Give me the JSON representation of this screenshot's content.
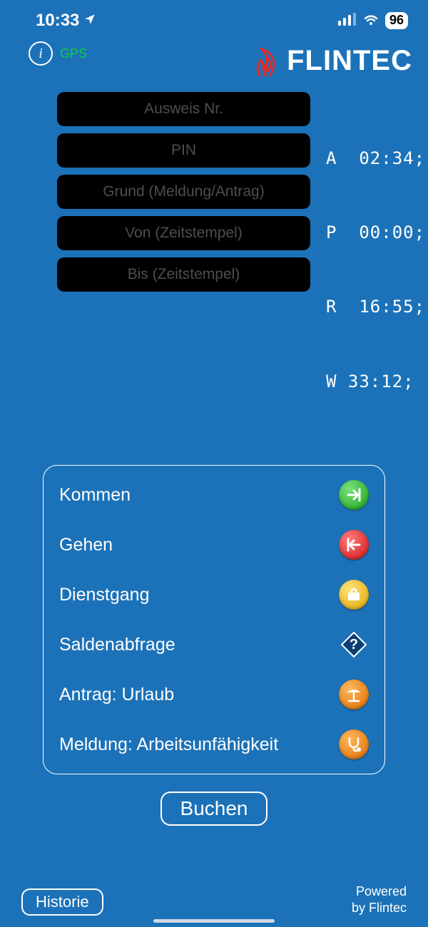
{
  "status": {
    "time": "10:33",
    "battery": "96"
  },
  "header": {
    "gps": "GPS",
    "brand": "FLINTEC"
  },
  "fields": {
    "ausweis": "Ausweis Nr.",
    "pin": "PIN",
    "grund": "Grund (Meldung/Antrag)",
    "von": "Von (Zeitstempel)",
    "bis": "Bis (Zeitstempel)"
  },
  "stats": {
    "lines": [
      "A  02:34;",
      "P  00:00;",
      "R  16:55;",
      "W 33:12;"
    ]
  },
  "actions": [
    {
      "label": "Kommen",
      "icon": "arrive-icon"
    },
    {
      "label": "Gehen",
      "icon": "leave-icon"
    },
    {
      "label": "Dienstgang",
      "icon": "errand-icon"
    },
    {
      "label": "Saldenabfrage",
      "icon": "balance-icon"
    },
    {
      "label": "Antrag: Urlaub",
      "icon": "vacation-icon"
    },
    {
      "label": "Meldung: Arbeitsunfähigkeit",
      "icon": "sick-icon"
    }
  ],
  "buttons": {
    "book": "Buchen",
    "history": "Historie"
  },
  "footer": {
    "powered1": "Powered",
    "powered2": "by Flintec"
  }
}
